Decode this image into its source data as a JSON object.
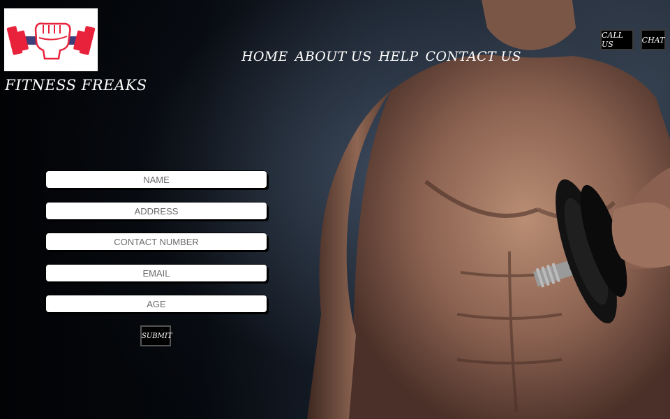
{
  "brand": {
    "name": "FITNESS FREAKS",
    "logo_icon": "dumbbell-fist-icon",
    "logo_colors": {
      "plates": "#e8223a",
      "bar": "#3c3f7a"
    }
  },
  "nav": {
    "items": [
      {
        "label": "HOME"
      },
      {
        "label": "ABOUT US"
      },
      {
        "label": "HELP"
      },
      {
        "label": "CONTACT US"
      }
    ]
  },
  "corner_buttons": {
    "call_label": "CALL US",
    "chat_label": "CHAT"
  },
  "form": {
    "fields": [
      {
        "placeholder": "NAME"
      },
      {
        "placeholder": "ADDRESS"
      },
      {
        "placeholder": "CONTACT NUMBER"
      },
      {
        "placeholder": "EMAIL"
      },
      {
        "placeholder": "AGE"
      }
    ],
    "submit_label": "SUBMIT"
  },
  "hero": {
    "image": "muscular-man-with-dumbbell"
  }
}
